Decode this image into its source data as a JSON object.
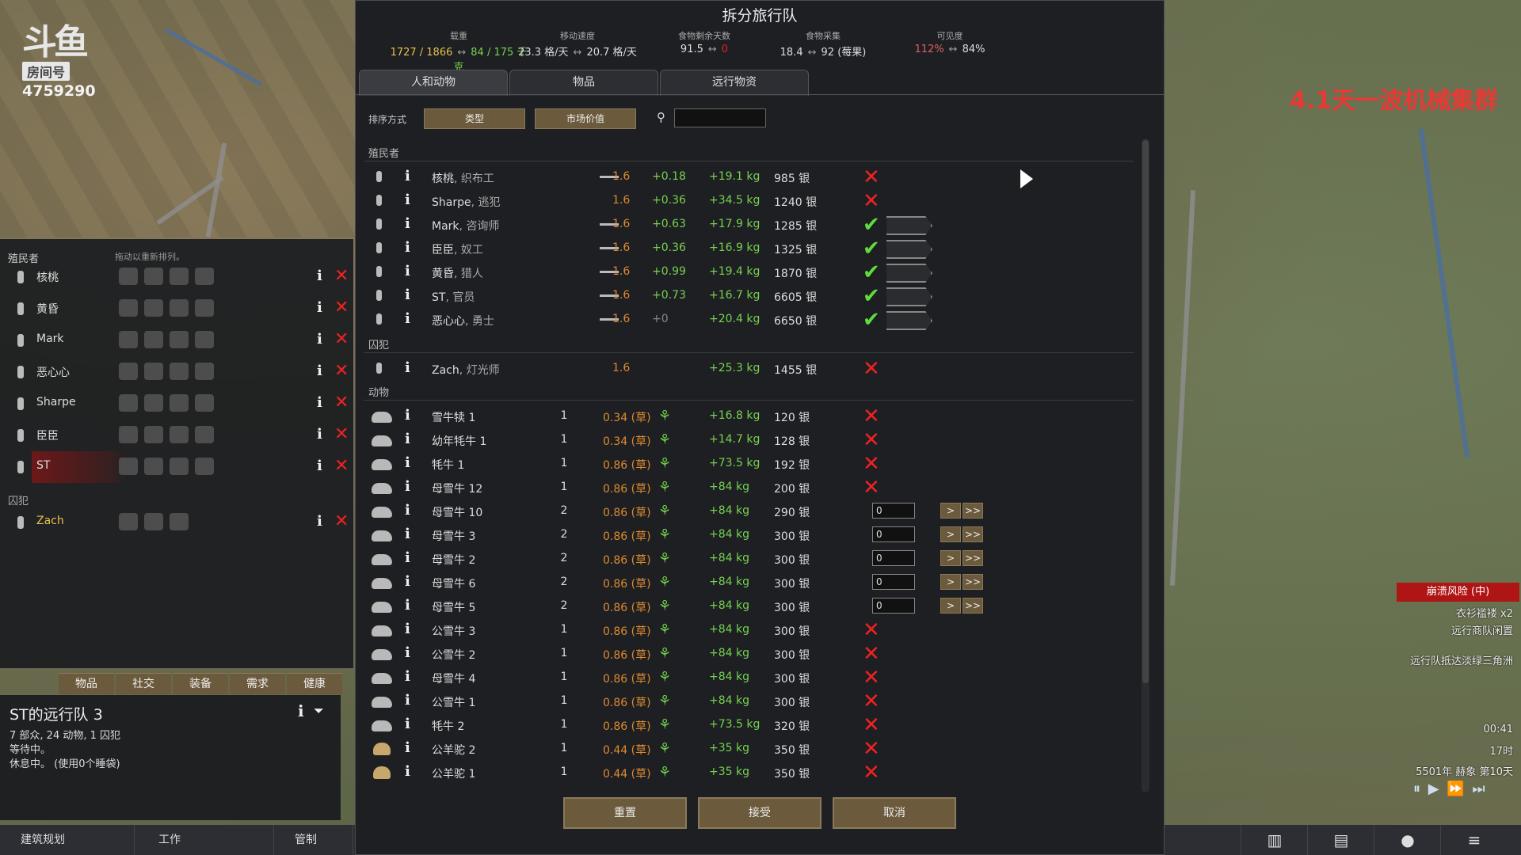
{
  "watermark": {
    "glyph": "斗鱼",
    "room_label": "房间号",
    "room_number": "4759290"
  },
  "overlay_text": "4.1天一波机械集群",
  "colonist_bar": {
    "header": "殖民者",
    "hint": "拖动以重新排列。",
    "colonists": [
      {
        "name": "核桃"
      },
      {
        "name": "黄昏"
      },
      {
        "name": "Mark"
      },
      {
        "name": "恶心心"
      },
      {
        "name": "Sharpe"
      },
      {
        "name": "臣臣"
      },
      {
        "name": "ST"
      }
    ],
    "prisoner_header": "囚犯",
    "prisoners": [
      {
        "name": "Zach"
      }
    ],
    "tabs": [
      "物品",
      "社交",
      "装备",
      "需求",
      "健康"
    ]
  },
  "caravan": {
    "title": "ST的远行队 3",
    "lines": [
      "7 部众, 24 动物, 1 囚犯",
      "等待中。",
      "休息中。 (使用0个睡袋)"
    ]
  },
  "bottom_bar": {
    "items": [
      "建筑规划",
      "工作",
      "管制"
    ],
    "icons": [
      "book-icon",
      "chart-icon",
      "bulb-icon",
      "menu-icon"
    ]
  },
  "dialog": {
    "title": "拆分旅行队",
    "stats": [
      {
        "label": "载重",
        "value_a": "1727 / 1866",
        "arrow": "↔",
        "value_b": "84 / 175 千克",
        "color_a": "#e8c04a",
        "color_b": "#77d24f"
      },
      {
        "label": "移动速度",
        "value_a": "23.3 格/天",
        "arrow": "↔",
        "value_b": "20.7 格/天",
        "color_a": "#dddddd",
        "color_b": "#dddddd"
      },
      {
        "label": "食物剩余天数",
        "value_a": "91.5",
        "arrow": "↔",
        "value_b": "0",
        "color_a": "#dddddd",
        "color_b": "#e22222"
      },
      {
        "label": "食物采集",
        "value_a": "18.4",
        "arrow": "↔",
        "value_b": "92 (莓果)",
        "color_a": "#dddddd",
        "color_b": "#dddddd"
      },
      {
        "label": "可见度",
        "value_a": "112%",
        "arrow": "↔",
        "value_b": "84%",
        "color_a": "#e06060",
        "color_b": "#dddddd"
      }
    ],
    "tabs": [
      "人和动物",
      "物品",
      "远行物资"
    ],
    "sort_label": "排序方式",
    "sort_buttons": [
      "类型",
      "市场价值"
    ],
    "search_value": "",
    "sections": {
      "colonists": "殖民者",
      "prisoners": "囚犯",
      "animals": "动物"
    },
    "colonist_rows": [
      {
        "name": "核桃",
        "role": "织布工",
        "mass": "1.6",
        "food": "+0.18",
        "cap": "+19.1 kg",
        "value": "985 银",
        "state": "x"
      },
      {
        "name": "Sharpe",
        "role": "逃犯",
        "mass": "1.6",
        "food": "+0.36",
        "cap": "+34.5 kg",
        "value": "1240 银",
        "state": "x"
      },
      {
        "name": "Mark",
        "role": "咨询师",
        "mass": "1.6",
        "food": "+0.63",
        "cap": "+17.9 kg",
        "value": "1285 银",
        "state": "check"
      },
      {
        "name": "臣臣",
        "role": "奴工",
        "mass": "1.6",
        "food": "+0.36",
        "cap": "+16.9 kg",
        "value": "1325 银",
        "state": "check"
      },
      {
        "name": "黄昏",
        "role": "猎人",
        "mass": "1.6",
        "food": "+0.99",
        "cap": "+19.4 kg",
        "value": "1870 银",
        "state": "check"
      },
      {
        "name": "ST",
        "role": "官员",
        "mass": "1.6",
        "food": "+0.73",
        "cap": "+16.7 kg",
        "value": "6605 银",
        "state": "check"
      },
      {
        "name": "恶心心",
        "role": "勇士",
        "mass": "1.6",
        "food": "+0",
        "cap": "+20.4 kg",
        "value": "6650 银",
        "state": "check"
      }
    ],
    "prisoner_rows": [
      {
        "name": "Zach",
        "role": "灯光师",
        "mass": "1.6",
        "cap": "+25.3 kg",
        "value": "1455 银",
        "state": "x"
      }
    ],
    "animal_rows": [
      {
        "name": "雪牛犊 1",
        "icon": "animal",
        "count": "1",
        "mass": "0.34 (草)",
        "cap": "+16.8 kg",
        "value": "120 银",
        "state": "x"
      },
      {
        "name": "幼年牦牛 1",
        "icon": "animal",
        "count": "1",
        "mass": "0.34 (草)",
        "cap": "+14.7 kg",
        "value": "128 银",
        "state": "x"
      },
      {
        "name": "牦牛 1",
        "icon": "animal",
        "count": "1",
        "mass": "0.86 (草)",
        "cap": "+73.5 kg",
        "value": "192 银",
        "state": "x"
      },
      {
        "name": "母雪牛 12",
        "icon": "animal",
        "count": "1",
        "mass": "0.86 (草)",
        "cap": "+84 kg",
        "value": "200 银",
        "state": "x"
      },
      {
        "name": "母雪牛 10",
        "icon": "animal",
        "count": "2",
        "mass": "0.86 (草)",
        "cap": "+84 kg",
        "value": "290 银",
        "state": "num",
        "num": "0"
      },
      {
        "name": "母雪牛 3",
        "icon": "animal",
        "count": "2",
        "mass": "0.86 (草)",
        "cap": "+84 kg",
        "value": "300 银",
        "state": "num",
        "num": "0"
      },
      {
        "name": "母雪牛 2",
        "icon": "animal",
        "count": "2",
        "mass": "0.86 (草)",
        "cap": "+84 kg",
        "value": "300 银",
        "state": "num",
        "num": "0"
      },
      {
        "name": "母雪牛 6",
        "icon": "animal",
        "count": "2",
        "mass": "0.86 (草)",
        "cap": "+84 kg",
        "value": "300 银",
        "state": "num",
        "num": "0"
      },
      {
        "name": "母雪牛 5",
        "icon": "animal",
        "count": "2",
        "mass": "0.86 (草)",
        "cap": "+84 kg",
        "value": "300 银",
        "state": "num",
        "num": "0"
      },
      {
        "name": "公雪牛 3",
        "icon": "animal",
        "count": "1",
        "mass": "0.86 (草)",
        "cap": "+84 kg",
        "value": "300 银",
        "state": "x"
      },
      {
        "name": "公雪牛 2",
        "icon": "animal",
        "count": "1",
        "mass": "0.86 (草)",
        "cap": "+84 kg",
        "value": "300 银",
        "state": "x"
      },
      {
        "name": "母雪牛 4",
        "icon": "animal",
        "count": "1",
        "mass": "0.86 (草)",
        "cap": "+84 kg",
        "value": "300 银",
        "state": "x"
      },
      {
        "name": "公雪牛 1",
        "icon": "animal",
        "count": "1",
        "mass": "0.86 (草)",
        "cap": "+84 kg",
        "value": "300 银",
        "state": "x"
      },
      {
        "name": "牦牛 2",
        "icon": "animal",
        "count": "1",
        "mass": "0.86 (草)",
        "cap": "+73.5 kg",
        "value": "320 银",
        "state": "x"
      },
      {
        "name": "公羊驼 2",
        "icon": "camel",
        "count": "1",
        "mass": "0.44 (草)",
        "cap": "+35 kg",
        "value": "350 银",
        "state": "x"
      },
      {
        "name": "公羊驼 1",
        "icon": "camel",
        "count": "1",
        "mass": "0.44 (草)",
        "cap": "+35 kg",
        "value": "350 银",
        "state": "x"
      }
    ],
    "footer_buttons": [
      "重置",
      "接受",
      "取消"
    ]
  },
  "right_hud": {
    "risk": "崩溃风险 (中)",
    "alerts": [
      "衣衫褴褛 x2",
      "远行商队闲置",
      "远行队抵达淡绿三角洲"
    ],
    "clock": "00:41",
    "hour": "17时",
    "date": "5501年 赫象 第10天"
  }
}
